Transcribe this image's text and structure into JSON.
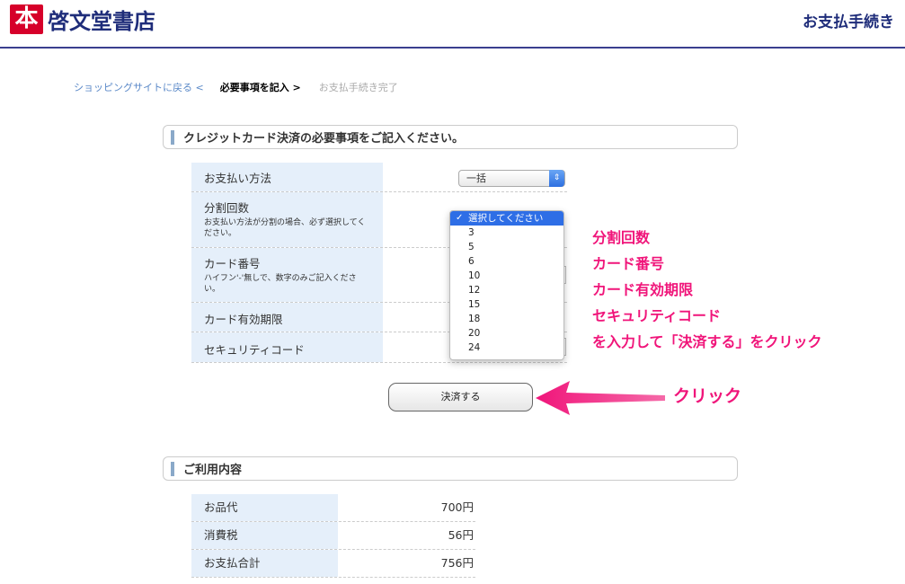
{
  "header": {
    "logo_mark": "本",
    "logo_text": "啓文堂書店",
    "right_title": "お支払手続き"
  },
  "breadcrumb": {
    "back": "ショッピングサイトに戻る <",
    "current": "必要事項を記入 >",
    "done": "お支払手続き完了"
  },
  "card_section": {
    "title": "クレジットカード決済の必要事項をご記入ください。"
  },
  "form": {
    "rows": [
      {
        "label": "お支払い方法",
        "note": ""
      },
      {
        "label": "分割回数",
        "note": "お支払い方法が分割の場合、必ず選択してください。"
      },
      {
        "label": "カード番号",
        "note": "ハイフン'-'無しで、数字のみご記入ください。"
      },
      {
        "label": "カード有効期限",
        "note": ""
      },
      {
        "label": "セキュリティコード",
        "note": ""
      }
    ],
    "payment_method_value": "一括",
    "installments_options": [
      "選択してください",
      "3",
      "5",
      "6",
      "10",
      "12",
      "15",
      "18",
      "20",
      "24"
    ],
    "installments_selected": "選択してください"
  },
  "pay_button_label": "決済する",
  "annotation": {
    "lines": [
      "分割回数",
      "カード番号",
      "カード有効期限",
      "セキュリティコード",
      "を入力して「決済する」をクリック"
    ],
    "click": "クリック",
    "color": "#f0157a"
  },
  "summary_section": {
    "title": "ご利用内容",
    "rows": [
      {
        "label": "お品代",
        "value": "700円"
      },
      {
        "label": "消費税",
        "value": "56円"
      },
      {
        "label": "お支払合計",
        "value": "756円"
      }
    ]
  }
}
